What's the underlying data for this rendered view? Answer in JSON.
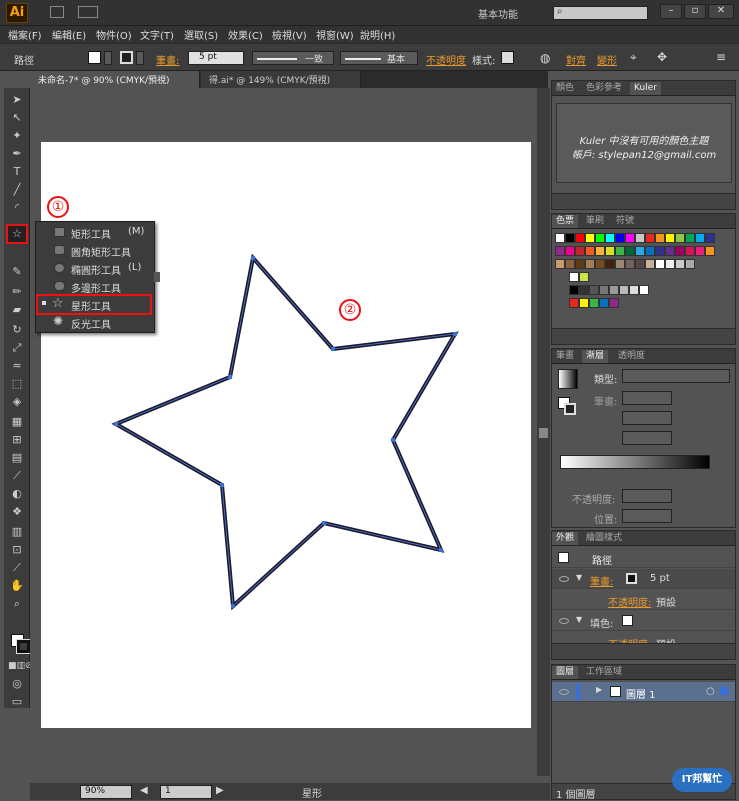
{
  "app": {
    "logo": "Ai",
    "workspace": "基本功能"
  },
  "menu": [
    "檔案(F)",
    "編輯(E)",
    "物件(O)",
    "文字(T)",
    "選取(S)",
    "效果(C)",
    "檢視(V)",
    "視窗(W)",
    "說明(H)"
  ],
  "control": {
    "path_label": "路徑",
    "stroke_label": "筆畫:",
    "stroke_value": "5 pt",
    "profile": "一致",
    "brush": "基本",
    "opacity_label": "不透明度",
    "style_label": "樣式:",
    "align_label": "對齊",
    "transform_label": "變形"
  },
  "tabs": [
    "未命名-7* @ 90% (CMYK/預視)",
    "得.ai* @ 149% (CMYK/預視)"
  ],
  "flyout": {
    "items": [
      {
        "label": "矩形工具",
        "key": "(M)"
      },
      {
        "label": "圓角矩形工具",
        "key": ""
      },
      {
        "label": "橢圓形工具",
        "key": "(L)"
      },
      {
        "label": "多邊形工具",
        "key": ""
      },
      {
        "label": "星形工具",
        "key": ""
      },
      {
        "label": "反光工具",
        "key": ""
      }
    ]
  },
  "callouts": [
    "①",
    "②"
  ],
  "status": {
    "zoom": "90%",
    "page": "1",
    "tool": "星形"
  },
  "kuler": {
    "tabs": [
      "顏色",
      "色彩參考",
      "Kuler"
    ],
    "line1": "Kuler 中沒有可用的顏色主題",
    "line2": "帳戶: stylepan12@gmail.com"
  },
  "swatches": {
    "tabs": [
      "色票",
      "筆刷",
      "符號"
    ]
  },
  "gradient": {
    "tabs": [
      "筆畫",
      "漸層",
      "透明度"
    ],
    "type_label": "類型:",
    "stroke_label": "筆畫:",
    "opacity_label": "不透明度:",
    "position_label": "位置:"
  },
  "appearance": {
    "tabs": [
      "外觀",
      "繪圖樣式"
    ],
    "title": "路徑",
    "stroke_label": "筆畫:",
    "stroke_value": "5 pt",
    "opacity_label": "不透明度:",
    "opacity_value": "預設",
    "fill_label": "填色:",
    "opacity2_label": "不透明度:",
    "opacity2_value": "預設"
  },
  "layers": {
    "tabs": [
      "圖層",
      "工作區域"
    ],
    "layer_name": "圖層 1",
    "count": "1 個圖層"
  },
  "colors": {
    "accent": "#e8982c",
    "red": "#e11111",
    "star_stroke": "#1a1a2e",
    "anchor": "#3b6fd8"
  },
  "watermark": "IT邦幫忙"
}
